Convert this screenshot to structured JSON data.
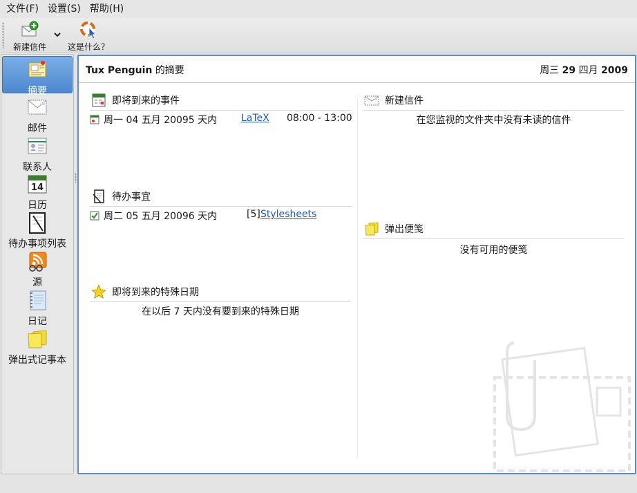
{
  "menubar": {
    "items": [
      {
        "label": "文件(F)"
      },
      {
        "label": "设置(S)"
      },
      {
        "label": "帮助(H)"
      }
    ]
  },
  "toolbar": {
    "new_mail": {
      "label": "新建信件",
      "icon": "new-mail-icon"
    },
    "whats_this": {
      "label": "这是什么？",
      "icon": "whats-this-icon"
    }
  },
  "sidebar": {
    "items": [
      {
        "label": "摘要",
        "icon": "summary-icon",
        "active": true
      },
      {
        "label": "邮件",
        "icon": "mail-icon"
      },
      {
        "label": "联系人",
        "icon": "contacts-icon"
      },
      {
        "label": "日历",
        "icon": "calendar-icon",
        "day": "14"
      },
      {
        "label": "待办事项列表",
        "icon": "todo-list-icon"
      },
      {
        "label": "源",
        "icon": "feeds-icon"
      },
      {
        "label": "日记",
        "icon": "journal-icon"
      },
      {
        "label": "弹出式记事本",
        "icon": "popup-notes-icon"
      }
    ]
  },
  "summary": {
    "title_user": "Tux Penguin",
    "title_suffix": " 的摘要",
    "date_prefix": "周三 ",
    "date_bold": "29",
    "date_mid": " 四月 ",
    "date_year": "2009",
    "events": {
      "heading": "即将到来的事件",
      "item": {
        "date": "周一 04 五月 2009",
        "days": "5 天内",
        "title": "LaTeX",
        "time": "08:00 - 13:00"
      }
    },
    "todos": {
      "heading": "待办事宜",
      "item": {
        "date": "周二 05 五月 2009",
        "days": "6 天内",
        "priority": "[5]",
        "title": "Stylesheets"
      }
    },
    "special_dates": {
      "heading": "即将到来的特殊日期",
      "empty": "在以后 7 天内没有要到来的特殊日期"
    },
    "new_mail": {
      "heading": "新建信件",
      "empty": "在您监视的文件夹中没有未读的信件"
    },
    "notes": {
      "heading": "弹出便笺",
      "empty": "没有可用的便笺"
    }
  },
  "colors": {
    "accent": "#4d87cf",
    "link": "#1d5aa8",
    "panel_border": "#5e8bc5"
  }
}
